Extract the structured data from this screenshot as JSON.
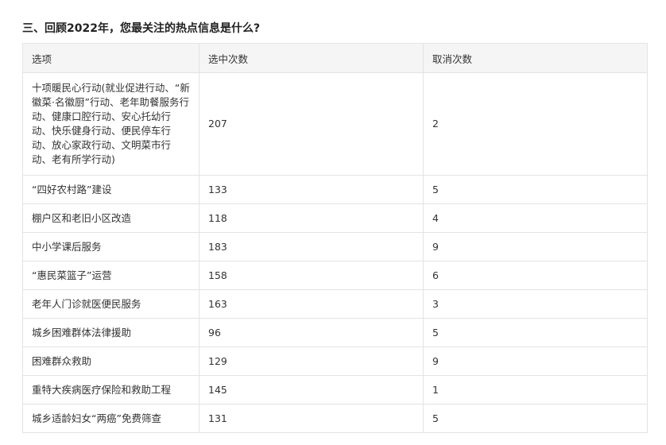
{
  "question": {
    "title": "三、回顾2022年，您最关注的热点信息是什么?"
  },
  "table": {
    "headers": [
      "选项",
      "选中次数",
      "取消次数"
    ],
    "rows": [
      {
        "option": "十项暖民心行动(就业促进行动、“新徽菜·名徽厨”行动、老年助餐服务行动、健康口腔行动、安心托幼行动、快乐健身行动、便民停车行动、放心家政行动、文明菜市行动、老有所学行动)",
        "selected": "207",
        "cancelled": "2"
      },
      {
        "option": "“四好农村路”建设",
        "selected": "133",
        "cancelled": "5"
      },
      {
        "option": "棚户区和老旧小区改造",
        "selected": "118",
        "cancelled": "4"
      },
      {
        "option": "中小学课后服务",
        "selected": "183",
        "cancelled": "9"
      },
      {
        "option": "“惠民菜篮子”运营",
        "selected": "158",
        "cancelled": "6"
      },
      {
        "option": "老年人门诊就医便民服务",
        "selected": "163",
        "cancelled": "3"
      },
      {
        "option": "城乡困难群体法律援助",
        "selected": "96",
        "cancelled": "5"
      },
      {
        "option": "困难群众救助",
        "selected": "129",
        "cancelled": "9"
      },
      {
        "option": "重特大疾病医疗保险和救助工程",
        "selected": "145",
        "cancelled": "1"
      },
      {
        "option": "城乡适龄妇女“两癌”免费筛查",
        "selected": "131",
        "cancelled": "5"
      }
    ]
  }
}
